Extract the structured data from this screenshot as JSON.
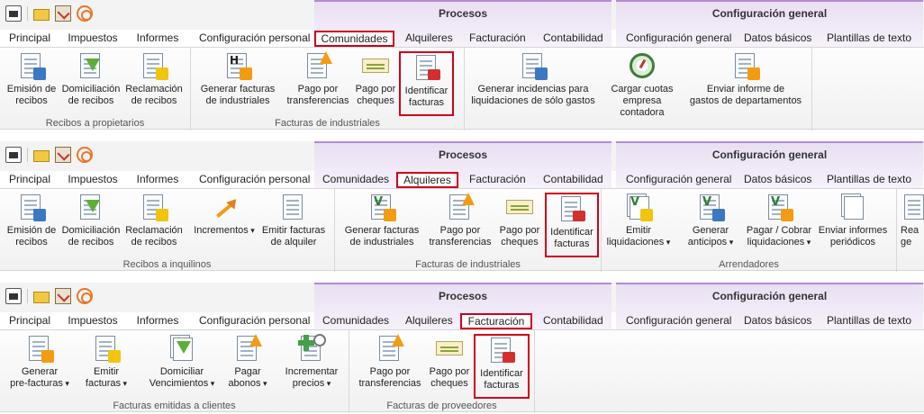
{
  "quick_access": {
    "icons": [
      "calendar-icon",
      "mail-icon",
      "clipboard-check-icon",
      "signal-icon"
    ]
  },
  "context_groups": {
    "procesos": "Procesos",
    "config": "Configuración general"
  },
  "tabs": {
    "principal": "Principal",
    "impuestos": "Impuestos",
    "informes": "Informes",
    "config_personal": "Configuración personal",
    "comunidades": "Comunidades",
    "alquileres": "Alquileres",
    "facturacion": "Facturación",
    "contabilidad": "Contabilidad",
    "config_general": "Configuración general",
    "datos_basicos": "Datos básicos",
    "plantillas": "Plantillas de texto"
  },
  "ribbon1": {
    "selected_tab": "Comunidades",
    "groups": {
      "recibos": "Recibos a propietarios",
      "facturas": "Facturas de industriales"
    },
    "buttons": {
      "emision": "Emisión de\nrecibos",
      "domiciliacion": "Domiciliación\nde recibos",
      "reclamacion": "Reclamación\nde recibos",
      "generar_facturas": "Generar facturas\nde industriales",
      "pago_transferencias": "Pago por\ntransferencias",
      "pago_cheques": "Pago por\ncheques",
      "identificar": "Identificar\nfacturas",
      "incidencias": "Generar incidencias para\nliquidaciones de sólo gastos",
      "cuotas": "Cargar cuotas\nempresa contadora",
      "informe": "Enviar informe de\ngastos de departamentos"
    }
  },
  "ribbon2": {
    "selected_tab": "Alquileres",
    "groups": {
      "recibos": "Recibos a inquilinos",
      "facturas": "Facturas de industriales",
      "arrendadores": "Arrendadores"
    },
    "buttons": {
      "emision": "Emisión de\nrecibos",
      "domiciliacion": "Domiciliación\nde recibos",
      "reclamacion": "Reclamación\nde recibos",
      "incrementos": "Incrementos",
      "emitir_alquiler": "Emitir facturas\nde alquiler",
      "generar_facturas": "Generar facturas\nde industriales",
      "pago_transferencias": "Pago por\ntransferencias",
      "pago_cheques": "Pago por\ncheques",
      "identificar": "Identificar\nfacturas",
      "emitir_liq": "Emitir\nliquidaciones",
      "generar_anticipos": "Generar\nanticipos",
      "pagar_cobrar": "Pagar / Cobrar\nliquidaciones",
      "enviar_informes": "Enviar informes\nperiódicos",
      "partial": "Rea\nge"
    }
  },
  "ribbon3": {
    "selected_tab": "Facturación",
    "groups": {
      "clientes": "Facturas emitidas a clientes",
      "proveedores": "Facturas de proveedores"
    },
    "buttons": {
      "generar_pre": "Generar\npre-facturas",
      "emitir": "Emitir\nfacturas",
      "domiciliar": "Domiciliar\nVencimientos",
      "pagar": "Pagar\nabonos",
      "incrementar": "Incrementar\nprecios",
      "pago_transferencias": "Pago por\ntransferencias",
      "pago_cheques": "Pago por\ncheques",
      "identificar": "Identificar\nfacturas"
    }
  }
}
